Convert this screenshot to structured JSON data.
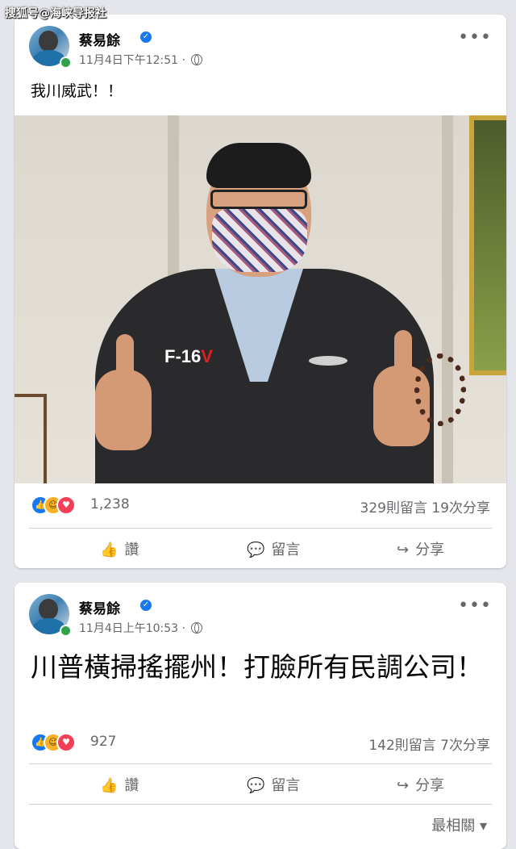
{
  "watermark": "搜狐号@海峡导报社",
  "posts": [
    {
      "author": "蔡易餘",
      "verified_icon": "verified-check-icon",
      "timestamp": "11月4日下午12:51 ·",
      "text": "我川威武！！",
      "photo": {
        "jacket_logo_main": "F-16",
        "jacket_logo_accent": "V"
      },
      "reaction_count": "1,238",
      "comments_shares": "329則留言 19次分享",
      "actions": {
        "like": "讚",
        "comment": "留言",
        "share": "分享"
      }
    },
    {
      "author": "蔡易餘",
      "verified_icon": "verified-check-icon",
      "timestamp": "11月4日上午10:53 ·",
      "text": "川普橫掃搖擺州！打臉所有民調公司！",
      "reaction_count": "927",
      "comments_shares": "142則留言 7次分享",
      "actions": {
        "like": "讚",
        "comment": "留言",
        "share": "分享"
      },
      "sort_label": "最相關"
    }
  ],
  "colors": {
    "facebook_blue": "#1877f2",
    "like": "#1877f2",
    "haha": "#f7b125",
    "love": "#f33e58",
    "online": "#31a24c"
  }
}
